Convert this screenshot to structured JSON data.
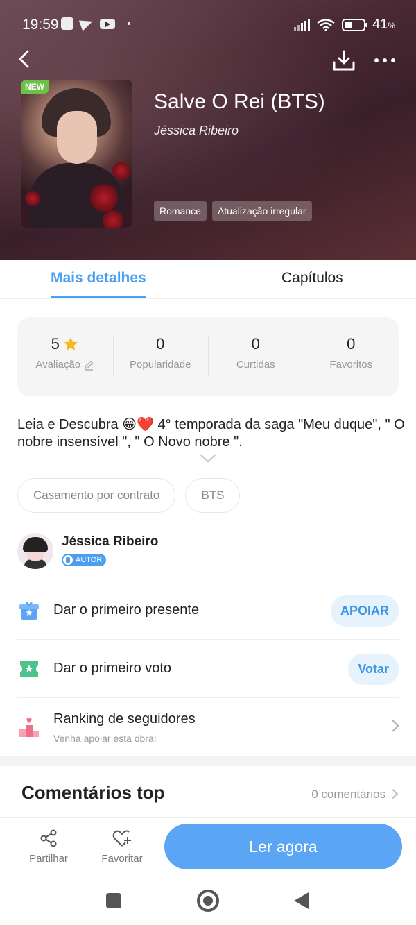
{
  "status_bar": {
    "time": "19:59",
    "battery": "41",
    "battery_unit": "%"
  },
  "book": {
    "badge": "NEW",
    "title": "Salve O Rei (BTS)",
    "author": "Jéssica Ribeiro",
    "tags": [
      "Romance",
      "Atualização irregular"
    ]
  },
  "tabs": [
    "Mais detalhes",
    "Capítulos"
  ],
  "stats": [
    {
      "value": "5",
      "label": "Avaliação"
    },
    {
      "value": "0",
      "label": "Popularidade"
    },
    {
      "value": "0",
      "label": "Curtidas"
    },
    {
      "value": "0",
      "label": "Favoritos"
    }
  ],
  "description": "Leia e Descubra 😁❤️ 4° temporada da saga \"Meu duque\", \" O nobre insensível \", \" O Novo nobre \".",
  "chips": [
    "Casamento por contrato",
    "BTS"
  ],
  "author_section": {
    "name": "Jéssica Ribeiro",
    "badge": "AUTOR"
  },
  "actions": [
    {
      "label": "Dar o primeiro presente",
      "button": "APOIAR"
    },
    {
      "label": "Dar o primeiro voto",
      "button": "Votar"
    },
    {
      "label": "Ranking de seguidores",
      "sub": "Venha apoiar esta obra!"
    }
  ],
  "comments": {
    "title": "Comentários top",
    "count": "0 comentários"
  },
  "bottom_bar": {
    "share": "Partilhar",
    "favorite": "Favoritar",
    "read": "Ler agora"
  },
  "colors": {
    "accent": "#4a9ff0",
    "read_button": "#5aa5f4",
    "new_badge": "#6cc04a",
    "pill_bg": "#e6f3fd"
  }
}
